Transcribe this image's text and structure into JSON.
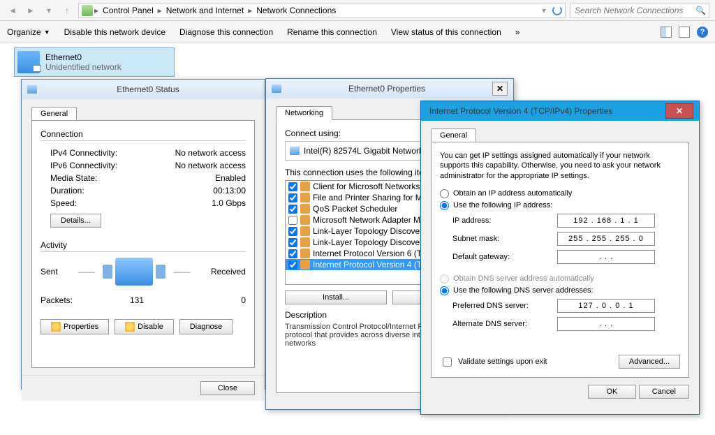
{
  "explorer": {
    "breadcrumb": [
      "Control Panel",
      "Network and Internet",
      "Network Connections"
    ],
    "search_placeholder": "Search Network Connections",
    "commands": {
      "organize": "Organize",
      "disable": "Disable this network device",
      "diagnose": "Diagnose this connection",
      "rename": "Rename this connection",
      "view_status": "View status of this connection",
      "more": "»"
    },
    "adapter": {
      "name": "Ethernet0",
      "status": "Unidentified network"
    }
  },
  "status": {
    "title": "Ethernet0 Status",
    "tab": "General",
    "conn_label": "Connection",
    "rows": {
      "ipv4_l": "IPv4 Connectivity:",
      "ipv4_v": "No network access",
      "ipv6_l": "IPv6 Connectivity:",
      "ipv6_v": "No network access",
      "media_l": "Media State:",
      "media_v": "Enabled",
      "dur_l": "Duration:",
      "dur_v": "00:13:00",
      "speed_l": "Speed:",
      "speed_v": "1.0 Gbps"
    },
    "details_btn": "Details...",
    "activity_label": "Activity",
    "sent_l": "Sent",
    "recv_l": "Received",
    "packets_l": "Packets:",
    "packets_sent": "131",
    "packets_recv": "0",
    "btn_props": "Properties",
    "btn_disable": "Disable",
    "btn_diag": "Diagnose",
    "close_btn": "Close"
  },
  "props": {
    "title": "Ethernet0 Properties",
    "tab": "Networking",
    "connect_using": "Connect using:",
    "adapter": "Intel(R) 82574L Gigabit Network Con",
    "items_label": "This connection uses the following items:",
    "items": [
      {
        "checked": true,
        "label": "Client for Microsoft Networks"
      },
      {
        "checked": true,
        "label": "File and Printer Sharing for Microso"
      },
      {
        "checked": true,
        "label": "QoS Packet Scheduler"
      },
      {
        "checked": false,
        "label": "Microsoft Network Adapter Multipl"
      },
      {
        "checked": true,
        "label": "Link-Layer Topology Discovery Ma"
      },
      {
        "checked": true,
        "label": "Link-Layer Topology Discovery Re"
      },
      {
        "checked": true,
        "label": "Internet Protocol Version 6 (TCP/I"
      },
      {
        "checked": true,
        "label": "Internet Protocol Version 4 (TCP/I",
        "selected": true
      }
    ],
    "install_btn": "Install...",
    "uninstall_btn": "Uninstall",
    "desc_label": "Description",
    "desc_text": "Transmission Control Protocol/Internet P wide area network protocol that provides across diverse interconnected networks"
  },
  "tcpip": {
    "title": "Internet Protocol Version 4 (TCP/IPv4) Properties",
    "tab": "General",
    "info": "You can get IP settings assigned automatically if your network supports this capability. Otherwise, you need to ask your network administrator for the appropriate IP settings.",
    "radio_auto_ip": "Obtain an IP address automatically",
    "radio_manual_ip": "Use the following IP address:",
    "ip_l": "IP address:",
    "ip_v": "192 . 168 .   1   .   1",
    "mask_l": "Subnet mask:",
    "mask_v": "255 . 255 . 255 .   0",
    "gw_l": "Default gateway:",
    "gw_v": ".         .         .",
    "radio_auto_dns": "Obtain DNS server address automatically",
    "radio_manual_dns": "Use the following DNS server addresses:",
    "pdns_l": "Preferred DNS server:",
    "pdns_v": "127 .   0   .   0   .   1",
    "adns_l": "Alternate DNS server:",
    "adns_v": ".         .         .",
    "validate": "Validate settings upon exit",
    "advanced_btn": "Advanced...",
    "ok_btn": "OK",
    "cancel_btn": "Cancel"
  }
}
